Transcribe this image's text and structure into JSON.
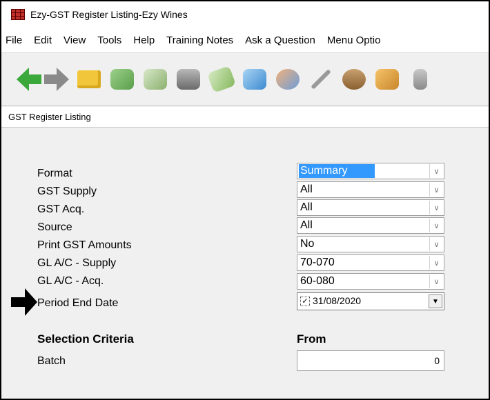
{
  "window": {
    "title": "Ezy-GST Register Listing-Ezy Wines"
  },
  "menu": [
    "File",
    "Edit",
    "View",
    "Tools",
    "Help",
    "Training Notes",
    "Ask a Question",
    "Menu Optio"
  ],
  "toolbar_icons": [
    "back-arrow-icon",
    "forward-arrow-icon",
    "folder-icon",
    "cash-icon",
    "payment-hand-icon",
    "bank-icon",
    "banknote-icon",
    "stamp-icon",
    "people-icon",
    "wrench-icon",
    "barrel-icon",
    "box-icon",
    "trolley-icon"
  ],
  "panel": {
    "title": "GST Register Listing"
  },
  "fields": [
    {
      "label": "Format",
      "value": "Summary"
    },
    {
      "label": "GST Supply",
      "value": "All"
    },
    {
      "label": "GST Acq.",
      "value": "All"
    },
    {
      "label": "Source",
      "value": "All"
    },
    {
      "label": "Print GST Amounts",
      "value": "No"
    },
    {
      "label": "GL A/C - Supply",
      "value": "70-070"
    },
    {
      "label": "GL A/C - Acq.",
      "value": "60-080"
    }
  ],
  "period": {
    "label": "Period End Date",
    "value": "31/08/2020",
    "checked": true
  },
  "selection": {
    "heading": "Selection Criteria",
    "from_heading": "From",
    "batch_label": "Batch",
    "batch_from": "0"
  },
  "colors": {
    "selection_highlight": "#3399ff",
    "app_icon": "#c0302a",
    "back_arrow": "#3aa83a"
  }
}
